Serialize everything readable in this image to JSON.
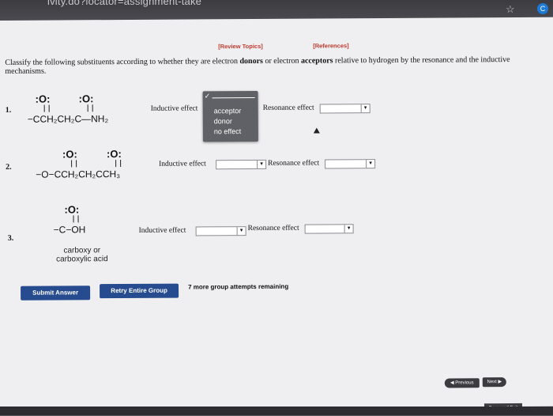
{
  "browser": {
    "url_fragment": "ivity.do?locator=assignment-take",
    "ext_label": "C"
  },
  "links": {
    "review_topics": "[Review Topics]",
    "references": "[References]"
  },
  "question": {
    "text_a": "Classify the following substituents according to whether they are electron ",
    "donors": "donors",
    "text_b": " or electron ",
    "acceptors": "acceptors",
    "text_c": " relative to hydrogen by the resonance and the inductive mechanisms."
  },
  "items": [
    {
      "number": "1.",
      "structure": "−CCH₂CH₂C—NH₂",
      "inductive_label": "Inductive effect",
      "resonance_label": "Resonance effect"
    },
    {
      "number": "2.",
      "structure": "−O−CCH₂CH₂CCH₃",
      "inductive_label": "Inductive effect",
      "resonance_label": "Resonance effect"
    },
    {
      "number": "3.",
      "structure": "−C−OH",
      "caption_1": "carboxy or",
      "caption_2": "carboxylic acid",
      "inductive_label": "Inductive effect",
      "resonance_label": "Resonance effect"
    }
  ],
  "atoms": {
    "carbonyl_o": ":O:",
    "ether_o": "O"
  },
  "dropdown": {
    "check": "✓",
    "options": [
      "acceptor",
      "donor",
      "no effect"
    ]
  },
  "buttons": {
    "submit": "Submit Answer",
    "retry": "Retry Entire Group"
  },
  "attempts": "7 more group attempts remaining",
  "nav": {
    "previous": "Previous",
    "next": "Next",
    "save_exit": "Save and Exit"
  }
}
